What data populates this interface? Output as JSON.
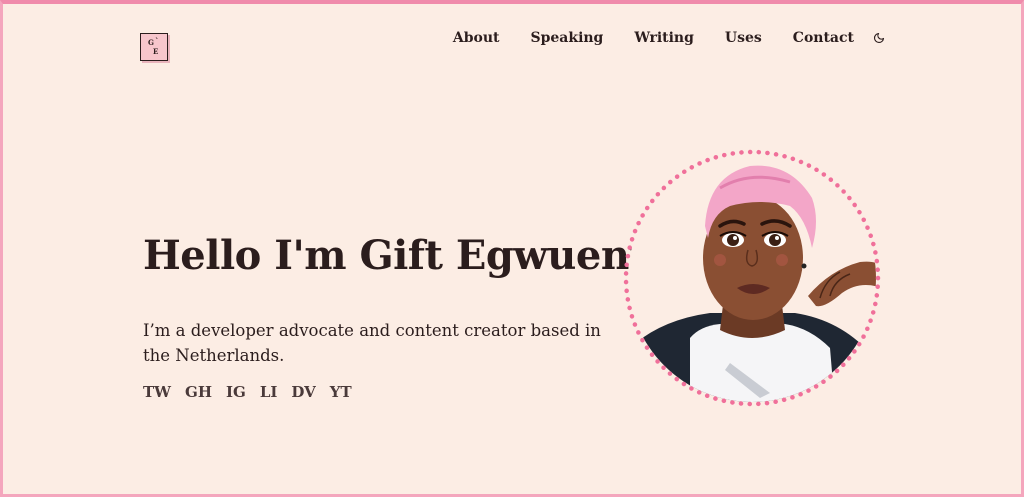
{
  "logo": {
    "g": "G",
    "tick": "`",
    "e": "E"
  },
  "nav": {
    "items": [
      "About",
      "Speaking",
      "Writing",
      "Uses",
      "Contact"
    ],
    "theme_icon": "moon-icon"
  },
  "hero": {
    "title": "Hello I'm Gift Egwuenu",
    "description": "I’m a developer advocate and content creator based in the Netherlands.",
    "socials": [
      "TW",
      "GH",
      "IG",
      "LI",
      "DV",
      "YT"
    ]
  },
  "colors": {
    "background": "#fcede4",
    "text": "#2b1d1d",
    "accent_pink": "#f0709a",
    "border_pink": "#f4a6bd"
  }
}
